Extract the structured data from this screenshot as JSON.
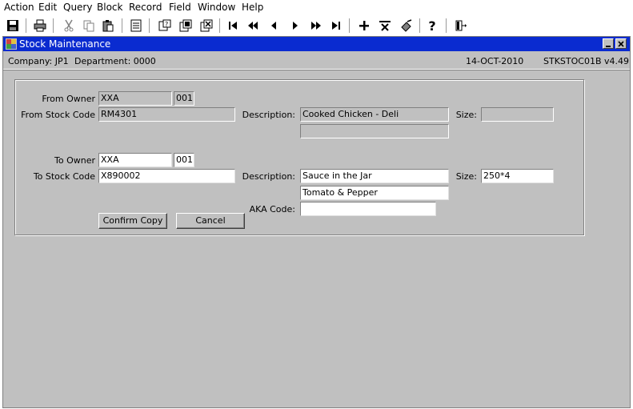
{
  "menu": [
    "Action",
    "Edit",
    "Query",
    "Block",
    "Record",
    "Field",
    "Window",
    "Help"
  ],
  "window": {
    "title": "Stock Maintenance",
    "company": "Company: JP1",
    "department": "Department: 0000",
    "date": "14-OCT-2010",
    "module": "STKSTOC01B v4.49"
  },
  "from": {
    "owner_label": "From Owner",
    "owner": "XXA",
    "owner_code": "001",
    "stock_label": "From Stock Code",
    "stock_code": "RM4301",
    "desc_label": "Description:",
    "desc1": "Cooked Chicken - Deli",
    "desc2": "",
    "size_label": "Size:",
    "size": ""
  },
  "to": {
    "owner_label": "To Owner",
    "owner": "XXA",
    "owner_code": "001",
    "stock_label": "To Stock Code",
    "stock_code": "X890002",
    "desc_label": "Description:",
    "desc1": "Sauce in the Jar",
    "desc2": "Tomato & Pepper",
    "size_label": "Size:",
    "size": "250*4",
    "aka_label": "AKA Code:",
    "aka": ""
  },
  "buttons": {
    "confirm": "Confirm Copy",
    "cancel": "Cancel"
  },
  "toolbar_icons": [
    "save-icon",
    "print-icon",
    "cut-icon",
    "copy-icon",
    "paste-icon",
    "list-icon",
    "query-icon",
    "execute-query-icon",
    "cancel-query-icon",
    "first-record-icon",
    "previous-page-icon",
    "previous-record-icon",
    "next-record-icon",
    "next-page-icon",
    "last-record-icon",
    "insert-record-icon",
    "delete-record-icon",
    "clear-record-icon",
    "help-icon",
    "exit-icon"
  ],
  "colors": {
    "titlebar": "#0a2bd0",
    "background": "#c0c0c0"
  }
}
